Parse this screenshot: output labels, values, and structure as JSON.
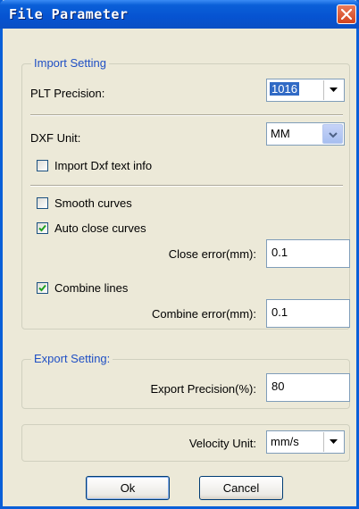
{
  "window": {
    "title": "File Parameter"
  },
  "import_setting": {
    "group_title": "Import Setting",
    "plt_precision_label": "PLT Precision:",
    "plt_precision_value": "1016",
    "dxf_unit_label": "DXF Unit:",
    "dxf_unit_value": "MM",
    "import_dxf_text_label": "Import Dxf text info",
    "import_dxf_text_checked": false,
    "smooth_curves_label": "Smooth curves",
    "smooth_curves_checked": false,
    "auto_close_label": "Auto close curves",
    "auto_close_checked": true,
    "close_error_label": "Close error(mm):",
    "close_error_value": "0.1",
    "combine_lines_label": "Combine lines",
    "combine_lines_checked": true,
    "combine_error_label": "Combine error(mm):",
    "combine_error_value": "0.1"
  },
  "export_setting": {
    "group_title": "Export Setting:",
    "export_precision_label": "Export Precision(%):",
    "export_precision_value": "80"
  },
  "velocity": {
    "label": "Velocity Unit:",
    "value": "mm/s"
  },
  "buttons": {
    "ok": "Ok",
    "cancel": "Cancel"
  },
  "icons": {
    "close": "close-icon",
    "dropdown": "chevron-down-icon",
    "check": "check-icon"
  },
  "colors": {
    "title_bar": "#0a5fd8",
    "dialog_bg": "#ece9d8",
    "group_title": "#1f4fc4",
    "close_button": "#d2431e"
  }
}
